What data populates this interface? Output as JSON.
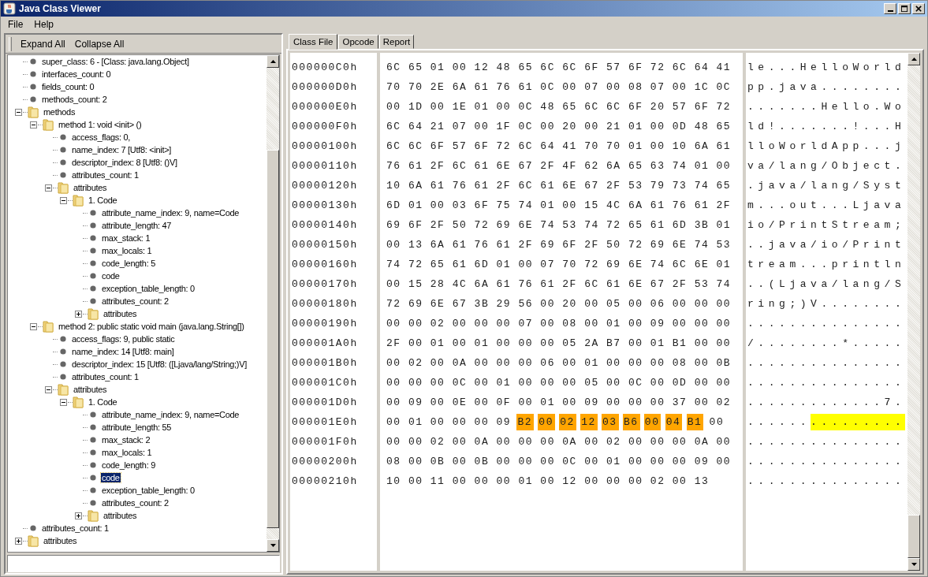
{
  "window": {
    "title": "Java Class Viewer"
  },
  "menu": [
    "File",
    "Help"
  ],
  "toolbar": [
    "Expand All",
    "Collapse All"
  ],
  "tree": [
    {
      "kind": "leaf",
      "label": "super_class: 6 - [Class: java.lang.Object]",
      "selected": false
    },
    {
      "kind": "leaf",
      "label": "interfaces_count: 0",
      "selected": false
    },
    {
      "kind": "leaf",
      "label": "fields_count: 0",
      "selected": false
    },
    {
      "kind": "leaf",
      "label": "methods_count: 2",
      "selected": false
    },
    {
      "kind": "folder",
      "label": "methods",
      "expanded": true,
      "selected": false,
      "children": [
        {
          "kind": "folder",
          "label": "method 1:  void <init> ()",
          "expanded": true,
          "selected": false,
          "children": [
            {
              "kind": "leaf",
              "label": "access_flags: 0,",
              "selected": false
            },
            {
              "kind": "leaf",
              "label": "name_index: 7 [Utf8: <init>]",
              "selected": false
            },
            {
              "kind": "leaf",
              "label": "descriptor_index: 8 [Utf8: ()V]",
              "selected": false
            },
            {
              "kind": "leaf",
              "label": "attributes_count: 1",
              "selected": false
            },
            {
              "kind": "folder",
              "label": "attributes",
              "expanded": true,
              "selected": false,
              "children": [
                {
                  "kind": "folder",
                  "label": "1. Code",
                  "expanded": true,
                  "selected": false,
                  "children": [
                    {
                      "kind": "leaf",
                      "label": "attribute_name_index: 9, name=Code",
                      "selected": false
                    },
                    {
                      "kind": "leaf",
                      "label": "attribute_length: 47",
                      "selected": false
                    },
                    {
                      "kind": "leaf",
                      "label": "max_stack: 1",
                      "selected": false
                    },
                    {
                      "kind": "leaf",
                      "label": "max_locals: 1",
                      "selected": false
                    },
                    {
                      "kind": "leaf",
                      "label": "code_length: 5",
                      "selected": false
                    },
                    {
                      "kind": "leaf",
                      "label": "code",
                      "selected": false
                    },
                    {
                      "kind": "leaf",
                      "label": "exception_table_length: 0",
                      "selected": false
                    },
                    {
                      "kind": "leaf",
                      "label": "attributes_count: 2",
                      "selected": false
                    },
                    {
                      "kind": "folder",
                      "label": "attributes",
                      "expanded": false,
                      "selected": false
                    }
                  ]
                }
              ]
            }
          ]
        },
        {
          "kind": "folder",
          "label": "method 2: public static void main (java.lang.String[])",
          "expanded": true,
          "selected": false,
          "children": [
            {
              "kind": "leaf",
              "label": "access_flags: 9, public static",
              "selected": false
            },
            {
              "kind": "leaf",
              "label": "name_index: 14 [Utf8: main]",
              "selected": false
            },
            {
              "kind": "leaf",
              "label": "descriptor_index: 15 [Utf8: ([Ljava/lang/String;)V]",
              "selected": false
            },
            {
              "kind": "leaf",
              "label": "attributes_count: 1",
              "selected": false
            },
            {
              "kind": "folder",
              "label": "attributes",
              "expanded": true,
              "selected": false,
              "children": [
                {
                  "kind": "folder",
                  "label": "1. Code",
                  "expanded": true,
                  "selected": false,
                  "children": [
                    {
                      "kind": "leaf",
                      "label": "attribute_name_index: 9, name=Code",
                      "selected": false
                    },
                    {
                      "kind": "leaf",
                      "label": "attribute_length: 55",
                      "selected": false
                    },
                    {
                      "kind": "leaf",
                      "label": "max_stack: 2",
                      "selected": false
                    },
                    {
                      "kind": "leaf",
                      "label": "max_locals: 1",
                      "selected": false
                    },
                    {
                      "kind": "leaf",
                      "label": "code_length: 9",
                      "selected": false
                    },
                    {
                      "kind": "leaf",
                      "label": "code",
                      "selected": true
                    },
                    {
                      "kind": "leaf",
                      "label": "exception_table_length: 0",
                      "selected": false
                    },
                    {
                      "kind": "leaf",
                      "label": "attributes_count: 2",
                      "selected": false
                    },
                    {
                      "kind": "folder",
                      "label": "attributes",
                      "expanded": false,
                      "selected": false
                    }
                  ]
                }
              ]
            }
          ]
        }
      ]
    },
    {
      "kind": "leaf",
      "label": "attributes_count: 1",
      "selected": false
    },
    {
      "kind": "folder",
      "label": "attributes",
      "expanded": false,
      "selected": false
    }
  ],
  "tabs": [
    {
      "label": "Class File",
      "selected": true
    },
    {
      "label": "Opcode",
      "selected": false
    },
    {
      "label": "Report",
      "selected": false
    }
  ],
  "hex_rows": [
    {
      "offset": "000000C0h",
      "hex": [
        {
          "text": "6C 65 01 00 12 48 65 6C 6C 6F 57 6F 72 6C 64 41",
          "highlighted": false
        }
      ],
      "ascii": [
        {
          "text": "le...HelloWorld",
          "highlighted": false
        }
      ]
    },
    {
      "offset": "000000D0h",
      "hex": [
        {
          "text": "70 70 2E 6A 61 76 61 0C 00 07 00 08 07 00 1C 0C",
          "highlighted": false
        }
      ],
      "ascii": [
        {
          "text": "pp.java........",
          "highlighted": false
        }
      ]
    },
    {
      "offset": "000000E0h",
      "hex": [
        {
          "text": "00 1D 00 1E 01 00 0C 48 65 6C 6C 6F 20 57 6F 72",
          "highlighted": false
        }
      ],
      "ascii": [
        {
          "text": ".......Hello.Wo",
          "highlighted": false
        }
      ]
    },
    {
      "offset": "000000F0h",
      "hex": [
        {
          "text": "6C 64 21 07 00 1F 0C 00 20 00 21 01 00 0D 48 65",
          "highlighted": false
        }
      ],
      "ascii": [
        {
          "text": "ld!.......!...H",
          "highlighted": false
        }
      ]
    },
    {
      "offset": "00000100h",
      "hex": [
        {
          "text": "6C 6C 6F 57 6F 72 6C 64 41 70 70 01 00 10 6A 61",
          "highlighted": false
        }
      ],
      "ascii": [
        {
          "text": "lloWorldApp...j",
          "highlighted": false
        }
      ]
    },
    {
      "offset": "00000110h",
      "hex": [
        {
          "text": "76 61 2F 6C 61 6E 67 2F 4F 62 6A 65 63 74 01 00",
          "highlighted": false
        }
      ],
      "ascii": [
        {
          "text": "va/lang/Object.",
          "highlighted": false
        }
      ]
    },
    {
      "offset": "00000120h",
      "hex": [
        {
          "text": "10 6A 61 76 61 2F 6C 61 6E 67 2F 53 79 73 74 65",
          "highlighted": false
        }
      ],
      "ascii": [
        {
          "text": ".java/lang/Syst",
          "highlighted": false
        }
      ]
    },
    {
      "offset": "00000130h",
      "hex": [
        {
          "text": "6D 01 00 03 6F 75 74 01 00 15 4C 6A 61 76 61 2F",
          "highlighted": false
        }
      ],
      "ascii": [
        {
          "text": "m...out...Ljava",
          "highlighted": false
        }
      ]
    },
    {
      "offset": "00000140h",
      "hex": [
        {
          "text": "69 6F 2F 50 72 69 6E 74 53 74 72 65 61 6D 3B 01",
          "highlighted": false
        }
      ],
      "ascii": [
        {
          "text": "io/PrintStream;",
          "highlighted": false
        }
      ]
    },
    {
      "offset": "00000150h",
      "hex": [
        {
          "text": "00 13 6A 61 76 61 2F 69 6F 2F 50 72 69 6E 74 53",
          "highlighted": false
        }
      ],
      "ascii": [
        {
          "text": "..java/io/Print",
          "highlighted": false
        }
      ]
    },
    {
      "offset": "00000160h",
      "hex": [
        {
          "text": "74 72 65 61 6D 01 00 07 70 72 69 6E 74 6C 6E 01",
          "highlighted": false
        }
      ],
      "ascii": [
        {
          "text": "tream...println",
          "highlighted": false
        }
      ]
    },
    {
      "offset": "00000170h",
      "hex": [
        {
          "text": "00 15 28 4C 6A 61 76 61 2F 6C 61 6E 67 2F 53 74",
          "highlighted": false
        }
      ],
      "ascii": [
        {
          "text": "..(Ljava/lang/S",
          "highlighted": false
        }
      ]
    },
    {
      "offset": "00000180h",
      "hex": [
        {
          "text": "72 69 6E 67 3B 29 56 00 20 00 05 00 06 00 00 00",
          "highlighted": false
        }
      ],
      "ascii": [
        {
          "text": "ring;)V........",
          "highlighted": false
        }
      ]
    },
    {
      "offset": "00000190h",
      "hex": [
        {
          "text": "00 00 02 00 00 00 07 00 08 00 01 00 09 00 00 00",
          "highlighted": false
        }
      ],
      "ascii": [
        {
          "text": "...............",
          "highlighted": false
        }
      ]
    },
    {
      "offset": "000001A0h",
      "hex": [
        {
          "text": "2F 00 01 00 01 00 00 00 05 2A B7 00 01 B1 00 00",
          "highlighted": false
        }
      ],
      "ascii": [
        {
          "text": "/........*.....",
          "highlighted": false
        }
      ]
    },
    {
      "offset": "000001B0h",
      "hex": [
        {
          "text": "00 02 00 0A 00 00 00 06 00 01 00 00 00 08 00 0B",
          "highlighted": false
        }
      ],
      "ascii": [
        {
          "text": "...............",
          "highlighted": false
        }
      ]
    },
    {
      "offset": "000001C0h",
      "hex": [
        {
          "text": "00 00 00 0C 00 01 00 00 00 05 00 0C 00 0D 00 00",
          "highlighted": false
        }
      ],
      "ascii": [
        {
          "text": "...............",
          "highlighted": false
        }
      ]
    },
    {
      "offset": "000001D0h",
      "hex": [
        {
          "text": "00 09 00 0E 00 0F 00 01 00 09 00 00 00 37 00 02",
          "highlighted": false
        }
      ],
      "ascii": [
        {
          "text": ".............7.",
          "highlighted": false
        }
      ]
    },
    {
      "offset": "000001E0h",
      "hex": [
        {
          "text": "00 01 00 00 00 09",
          "highlighted": false
        },
        {
          "text": "B2 00 02 12 03 B6 00 04 B1",
          "highlighted": true
        },
        {
          "text": "00",
          "highlighted": false
        }
      ],
      "ascii": [
        {
          "text": "......",
          "highlighted": false
        },
        {
          "text": ".........",
          "highlighted": true
        }
      ]
    },
    {
      "offset": "000001F0h",
      "hex": [
        {
          "text": "00 00 02 00 0A 00 00 00 0A 00 02 00 00 00 0A 00",
          "highlighted": false
        }
      ],
      "ascii": [
        {
          "text": "...............",
          "highlighted": false
        }
      ]
    },
    {
      "offset": "00000200h",
      "hex": [
        {
          "text": "08 00 0B 00 0B 00 00 00 0C 00 01 00 00 00 09 00",
          "highlighted": false
        }
      ],
      "ascii": [
        {
          "text": "...............",
          "highlighted": false
        }
      ]
    },
    {
      "offset": "00000210h",
      "hex": [
        {
          "text": "10 00 11 00 00 00 01 00 12 00 00 00 02 00 13",
          "highlighted": false
        }
      ],
      "ascii": [
        {
          "text": "...............",
          "highlighted": false
        }
      ]
    }
  ]
}
